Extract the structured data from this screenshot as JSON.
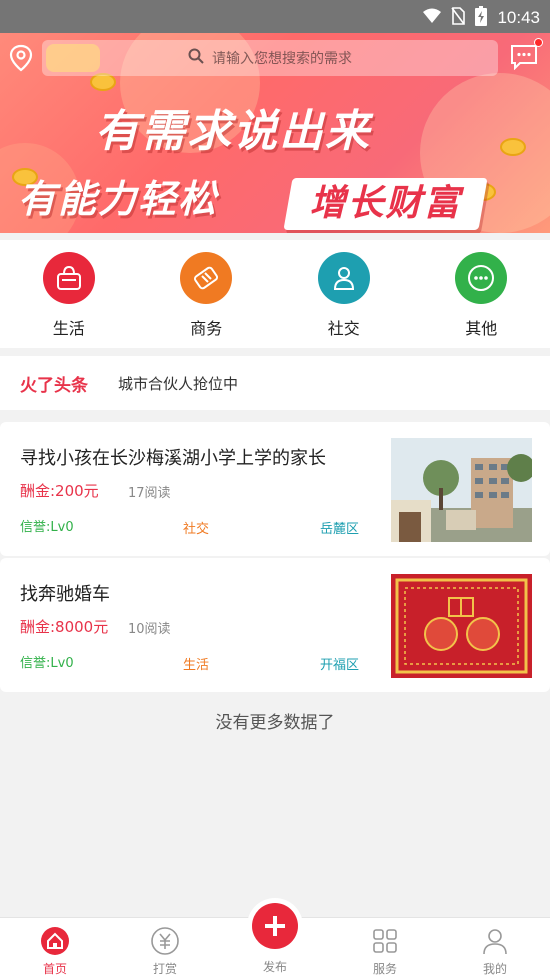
{
  "status_bar": {
    "time": "10:43"
  },
  "header": {
    "search_placeholder": "请输入您想搜索的需求"
  },
  "banner": {
    "line1": "有需求说出来",
    "line2": "有能力轻松",
    "highlight": "增长财富",
    "active_dot": 2
  },
  "categories": [
    {
      "label": "生活",
      "icon": "basket-icon",
      "color": "#e8283b"
    },
    {
      "label": "商务",
      "icon": "handshake-icon",
      "color": "#f07a22"
    },
    {
      "label": "社交",
      "icon": "people-icon",
      "color": "#1e9fb0"
    },
    {
      "label": "其他",
      "icon": "more-dots-icon",
      "color": "#32b14a"
    }
  ],
  "headline": {
    "tag": "火了头条",
    "text": "城市合伙人抢位中"
  },
  "posts": [
    {
      "title": "寻找小孩在长沙梅溪湖小学上学的家长",
      "reward": "酬金:200元",
      "reads": "17阅读",
      "credit": "信誉:Lv0",
      "category": "社交",
      "area": "岳麓区",
      "image": "school-building-photo"
    },
    {
      "title": "找奔驰婚车",
      "reward": "酬金:8000元",
      "reads": "10阅读",
      "credit": "信誉:Lv0",
      "category": "生活",
      "area": "开福区",
      "image": "red-wedding-decoration-photo"
    }
  ],
  "no_more_text": "没有更多数据了",
  "tabbar": {
    "tabs": [
      {
        "label": "首页",
        "icon": "home-icon",
        "active": true
      },
      {
        "label": "打赏",
        "icon": "yuan-coin-icon",
        "active": false
      },
      {
        "label": "发布",
        "icon": "plus-icon",
        "active": false
      },
      {
        "label": "服务",
        "icon": "grid-icon",
        "active": false
      },
      {
        "label": "我的",
        "icon": "user-icon",
        "active": false
      }
    ]
  },
  "colors": {
    "accent": "#e8334a",
    "credit": "#32b14a",
    "category": "#f07a22",
    "area": "#1e9fb0"
  }
}
